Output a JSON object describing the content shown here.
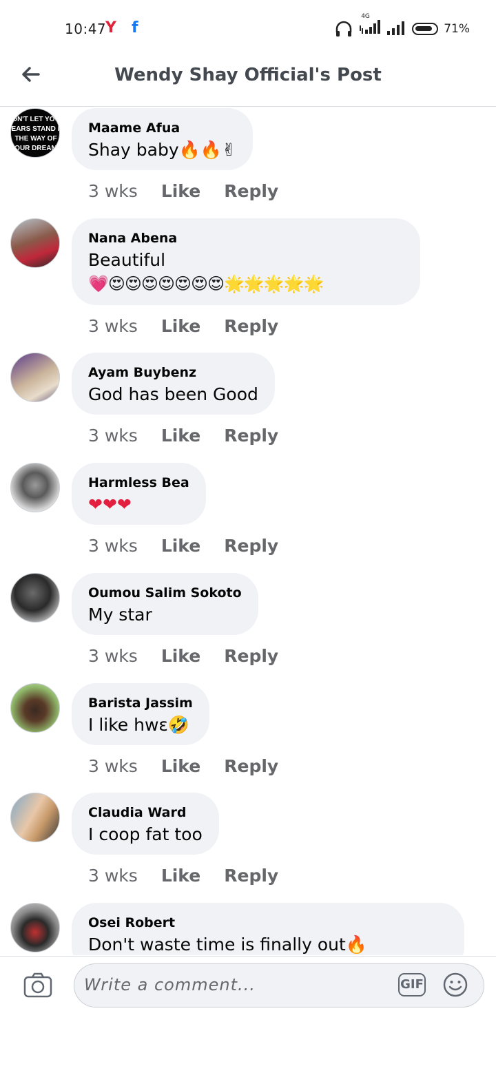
{
  "status_bar": {
    "time": "10:47",
    "youtube_icon": "Y",
    "facebook_icon": "f",
    "network": "4G",
    "battery": "71%"
  },
  "header": {
    "title": "Wendy Shay Official's Post"
  },
  "comments": [
    {
      "author": "Maame Afua",
      "text": "Shay baby🔥🔥✌",
      "time": "3 wks",
      "like": "Like",
      "reply": "Reply"
    },
    {
      "author": "Nana Abena",
      "text": "Beautiful",
      "extra": "💗😍😍😍😍😍😍😍🌟🌟🌟🌟🌟",
      "time": "3 wks",
      "like": "Like",
      "reply": "Reply"
    },
    {
      "author": "Ayam Buybenz",
      "text": "God has been Good",
      "time": "3 wks",
      "like": "Like",
      "reply": "Reply"
    },
    {
      "author": "Harmless Bea",
      "text": "❤❤❤",
      "time": "3 wks",
      "like": "Like",
      "reply": "Reply"
    },
    {
      "author": "Oumou Salim Sokoto",
      "text": "My star",
      "time": "3 wks",
      "like": "Like",
      "reply": "Reply"
    },
    {
      "author": "Barista Jassim",
      "text": "I like hwɛ🤣",
      "time": "3 wks",
      "like": "Like",
      "reply": "Reply"
    },
    {
      "author": "Claudia Ward",
      "text": "I coop fat too",
      "time": "3 wks",
      "like": "Like",
      "reply": "Reply"
    },
    {
      "author": "Osei Robert",
      "text": "Don't waste time is finally out🔥"
    }
  ],
  "avatar_text": [
    "DON'T LET YOUR",
    "FEARS STAND IN",
    "THE WAY OF",
    "YOUR DREAMS"
  ],
  "composer": {
    "placeholder": "Write a comment...",
    "gif_label": "GIF"
  },
  "colors": {
    "bubble": "#f0f2f5",
    "secondary_text": "#65676b",
    "youtube_red": "#e0243a",
    "facebook_blue": "#1877f2"
  }
}
